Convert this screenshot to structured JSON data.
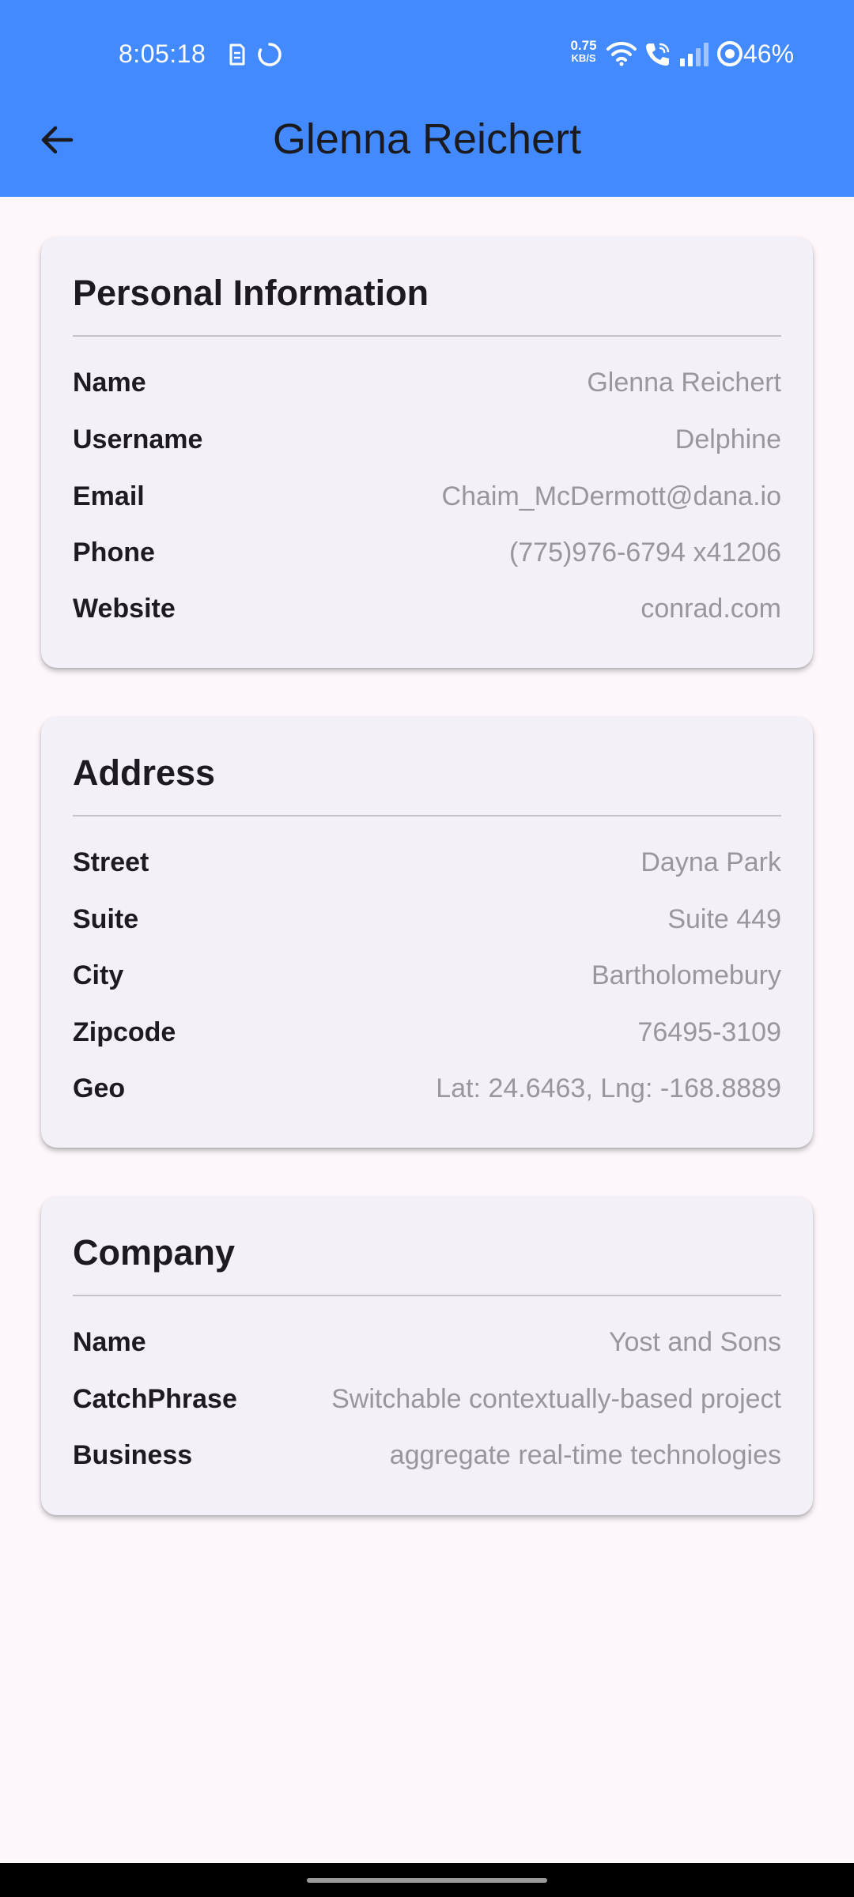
{
  "status_bar": {
    "time": "8:05:18",
    "net_speed_value": "0.75",
    "net_speed_unit": "KB/S",
    "battery": "46%"
  },
  "app_bar": {
    "title": "Glenna Reichert",
    "back_icon": "arrow-back-icon",
    "color": "#448AFF"
  },
  "sections": {
    "personal": {
      "title": "Personal Information",
      "rows": [
        {
          "label": "Name",
          "value": "Glenna Reichert"
        },
        {
          "label": "Username",
          "value": "Delphine"
        },
        {
          "label": "Email",
          "value": "Chaim_McDermott@dana.io"
        },
        {
          "label": "Phone",
          "value": "(775)976-6794 x41206"
        },
        {
          "label": "Website",
          "value": "conrad.com"
        }
      ]
    },
    "address": {
      "title": "Address",
      "rows": [
        {
          "label": "Street",
          "value": "Dayna Park"
        },
        {
          "label": "Suite",
          "value": "Suite 449"
        },
        {
          "label": "City",
          "value": "Bartholomebury"
        },
        {
          "label": "Zipcode",
          "value": "76495-3109"
        },
        {
          "label": "Geo",
          "value": "Lat: 24.6463, Lng: -168.8889"
        }
      ]
    },
    "company": {
      "title": "Company",
      "rows": [
        {
          "label": "Name",
          "value": "Yost and Sons"
        },
        {
          "label": "CatchPhrase",
          "value": "Switchable contextually-based project"
        },
        {
          "label": "Business",
          "value": "aggregate real-time technologies"
        }
      ]
    }
  },
  "colors": {
    "background": "#FDF7FC",
    "card": "#F4F0F7",
    "label": "#1D1B20",
    "value": "#9A969E"
  }
}
